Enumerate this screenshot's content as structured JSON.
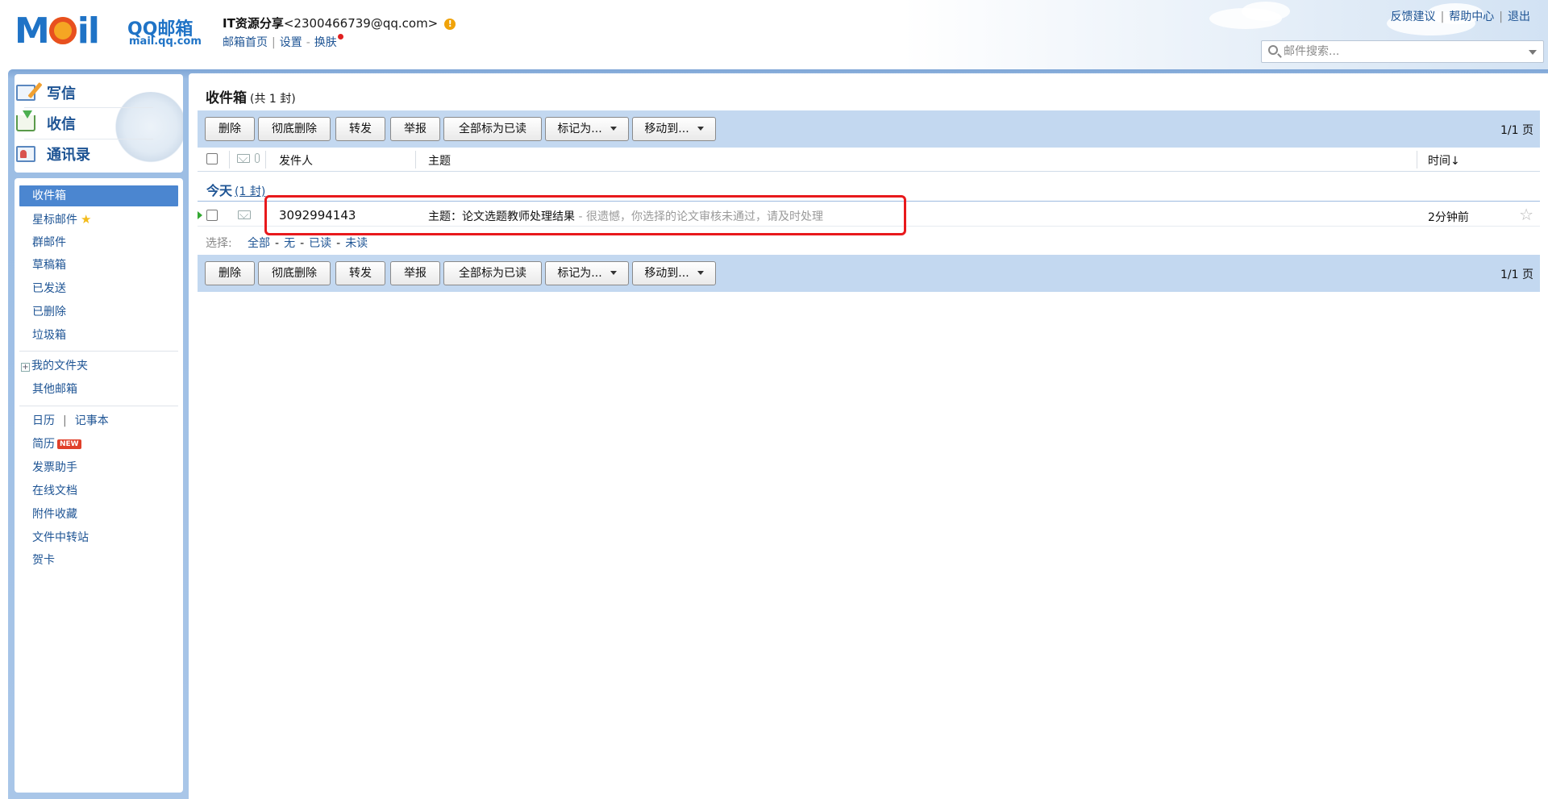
{
  "header": {
    "logo_brand": "QQ邮箱",
    "logo_url": "mail.qq.com",
    "account_name": "IT资源分享",
    "account_email": "<2300466739@qq.com>",
    "nav": [
      "邮箱首页",
      "设置",
      "换肤"
    ],
    "top_links": [
      "反馈建议",
      "帮助中心",
      "退出"
    ],
    "search_placeholder": "邮件搜索..."
  },
  "sidebar": {
    "actions": [
      "写信",
      "收信",
      "通讯录"
    ],
    "folders": [
      "收件箱",
      "星标邮件",
      "群邮件",
      "草稿箱",
      "已发送",
      "已删除",
      "垃圾箱"
    ],
    "my_folders": "我的文件夹",
    "other_mail": "其他邮箱",
    "tools": {
      "calendar": "日历",
      "notebook": "记事本",
      "resume": "简历",
      "new_badge": "NEW",
      "invoice": "发票助手",
      "docs": "在线文档",
      "attachments": "附件收藏",
      "transfer": "文件中转站",
      "cards": "贺卡"
    }
  },
  "main": {
    "title": "收件箱",
    "count_text": "(共 1 封)",
    "toolbar": {
      "delete": "删除",
      "delete_forever": "彻底删除",
      "forward": "转发",
      "report": "举报",
      "mark_all_read": "全部标为已读",
      "mark_as": "标记为...",
      "move_to": "移动到...",
      "pager": "1/1 页"
    },
    "columns": {
      "sender": "发件人",
      "subject": "主题",
      "time": "时间↓"
    },
    "group": {
      "label": "今天",
      "count": "(1 封)"
    },
    "rows": [
      {
        "sender": "3092994143",
        "subject": "主题：论文选题教师处理结果",
        "preview": " - 很遗憾，你选择的论文审核未通过，请及时处理",
        "time": "2分钟前"
      }
    ],
    "select": {
      "label": "选择:",
      "all": "全部",
      "none": "无",
      "read": "已读",
      "unread": "未读"
    }
  },
  "colors": {
    "accent": "#1e5494",
    "toolbar_bg": "#c3d8f0",
    "active_folder": "#4b86d0",
    "highlight": "#e8191c"
  }
}
